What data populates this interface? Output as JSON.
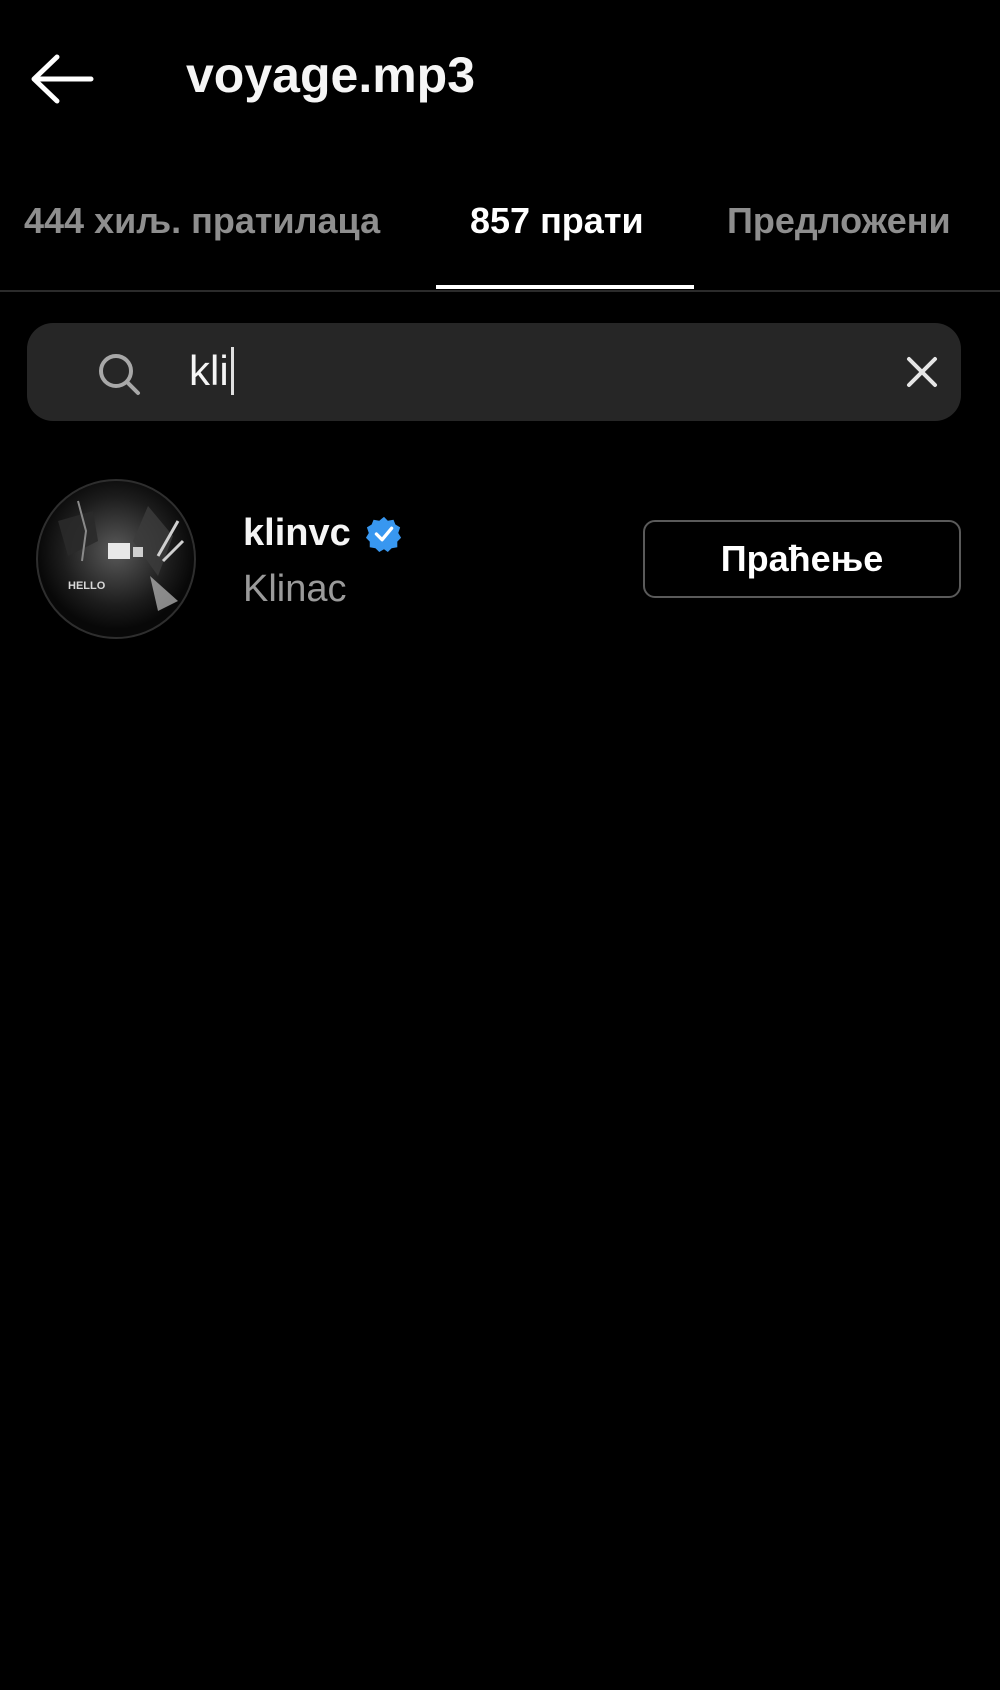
{
  "header": {
    "title": "voyage.mp3",
    "back_icon": "arrow-left-icon"
  },
  "tabs": [
    {
      "label": "444 хиљ. пратилаца",
      "active": false
    },
    {
      "label": "857 прати",
      "active": true
    },
    {
      "label": "Предложени",
      "active": false
    }
  ],
  "search": {
    "value": "kli",
    "icon": "search-icon",
    "clear_icon": "close-icon"
  },
  "results": [
    {
      "username": "klinvc",
      "verified": true,
      "full_name": "Klinac",
      "button_label": "Праћење",
      "avatar_text": "HELLO"
    }
  ],
  "colors": {
    "background": "#000000",
    "search_bg": "#262626",
    "verified_blue": "#3897f0",
    "muted_text": "#8e8e8e"
  }
}
